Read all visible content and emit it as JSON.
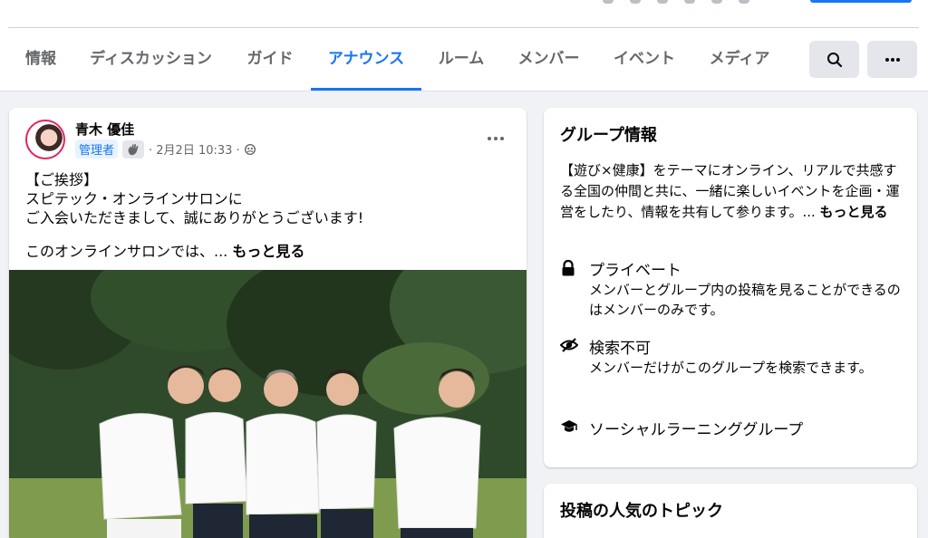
{
  "tabs": [
    {
      "label": "情報",
      "active": false
    },
    {
      "label": "ディスカッション",
      "active": false
    },
    {
      "label": "ガイド",
      "active": false
    },
    {
      "label": "アナウンス",
      "active": true
    },
    {
      "label": "ルーム",
      "active": false
    },
    {
      "label": "メンバー",
      "active": false
    },
    {
      "label": "イベント",
      "active": false
    },
    {
      "label": "メディア",
      "active": false
    }
  ],
  "tab_buttons": {
    "search_icon": "search-icon",
    "more_icon": "more-horizontal-icon"
  },
  "post": {
    "author": "青木 優佳",
    "badge": "管理者",
    "badge_icon": "waving-hand-icon",
    "date": "· 2月2日 10:33 ·",
    "privacy_icon": "group-icon",
    "more_icon": "more-horizontal-icon",
    "lines": [
      "【ご挨拶】",
      "スピテック・オンラインサロンに",
      "ご入会いただきまして、誠にありがとうございます!"
    ],
    "preview": "このオンラインサロンでは、...",
    "see_more": "もっと見る"
  },
  "group_info": {
    "title": "グループ情報",
    "description": "【遊び×健康】をテーマにオンライン、リアルで共感する全国の仲間と共に、一緒に楽しいイベントを企画・運営をしたり、情報を共有して参ります。...",
    "see_more": "もっと見る",
    "items": [
      {
        "icon": "lock-icon",
        "title": "プライベート",
        "subtitle": "メンバーとグループ内の投稿を見ることができるのはメンバーのみです。"
      },
      {
        "icon": "eye-off-icon",
        "title": "検索不可",
        "subtitle": "メンバーだけがこのグループを検索できます。"
      },
      {
        "icon": "graduation-cap-icon",
        "title": "ソーシャルラーニンググループ",
        "subtitle": ""
      }
    ]
  },
  "popular_topics": {
    "title": "投稿の人気のトピック"
  },
  "colors": {
    "accent": "#1877f2",
    "background": "#f0f2f5",
    "card": "#ffffff",
    "secondary_text": "#65676b"
  }
}
